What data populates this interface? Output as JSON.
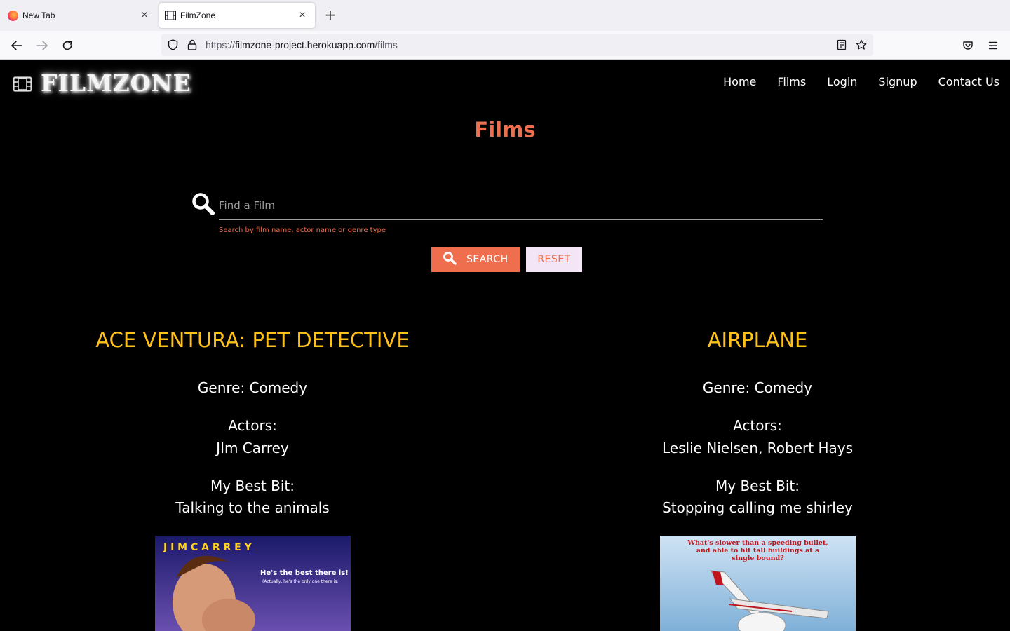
{
  "browser": {
    "tabs": [
      {
        "title": "New Tab",
        "active": false,
        "icon": "firefox-icon"
      },
      {
        "title": "FilmZone",
        "active": true,
        "icon": "film-icon"
      }
    ],
    "url": {
      "scheme": "https://",
      "host": "filmzone-project.herokuapp.com",
      "path": "/films"
    }
  },
  "site": {
    "brand": "FILMZONE",
    "nav": [
      "Home",
      "Films",
      "Login",
      "Signup",
      "Contact Us"
    ]
  },
  "page": {
    "title": "Films",
    "search": {
      "placeholder": "Find a Film",
      "helper": "Search by film name, actor name or genre type",
      "search_label": "SEARCH",
      "reset_label": "RESET"
    }
  },
  "films": [
    {
      "title": "ACE VENTURA: PET DETECTIVE",
      "genre": "Genre: Comedy",
      "actors_label": "Actors:",
      "actors": "JIm Carrey",
      "best_bit_label": "My Best Bit:",
      "best_bit": "Talking to the animals",
      "poster": {
        "line1": "J I M   C A R R E Y",
        "line2": "He's the best there is!",
        "line3": "(Actually, he's the only one there is.)"
      }
    },
    {
      "title": "AIRPLANE",
      "genre": "Genre: Comedy",
      "actors_label": "Actors:",
      "actors": "Leslie Nielsen, Robert Hays",
      "best_bit_label": "My Best Bit:",
      "best_bit": "Stopping calling me shirley",
      "poster": {
        "line1": "What's slower than a speeding bullet,",
        "line2": "and able to hit tall buildings at a",
        "line3": "single bound?"
      }
    }
  ],
  "colors": {
    "accent": "#ee6e4d",
    "film_title": "#ffc01a",
    "background": "#000000"
  }
}
